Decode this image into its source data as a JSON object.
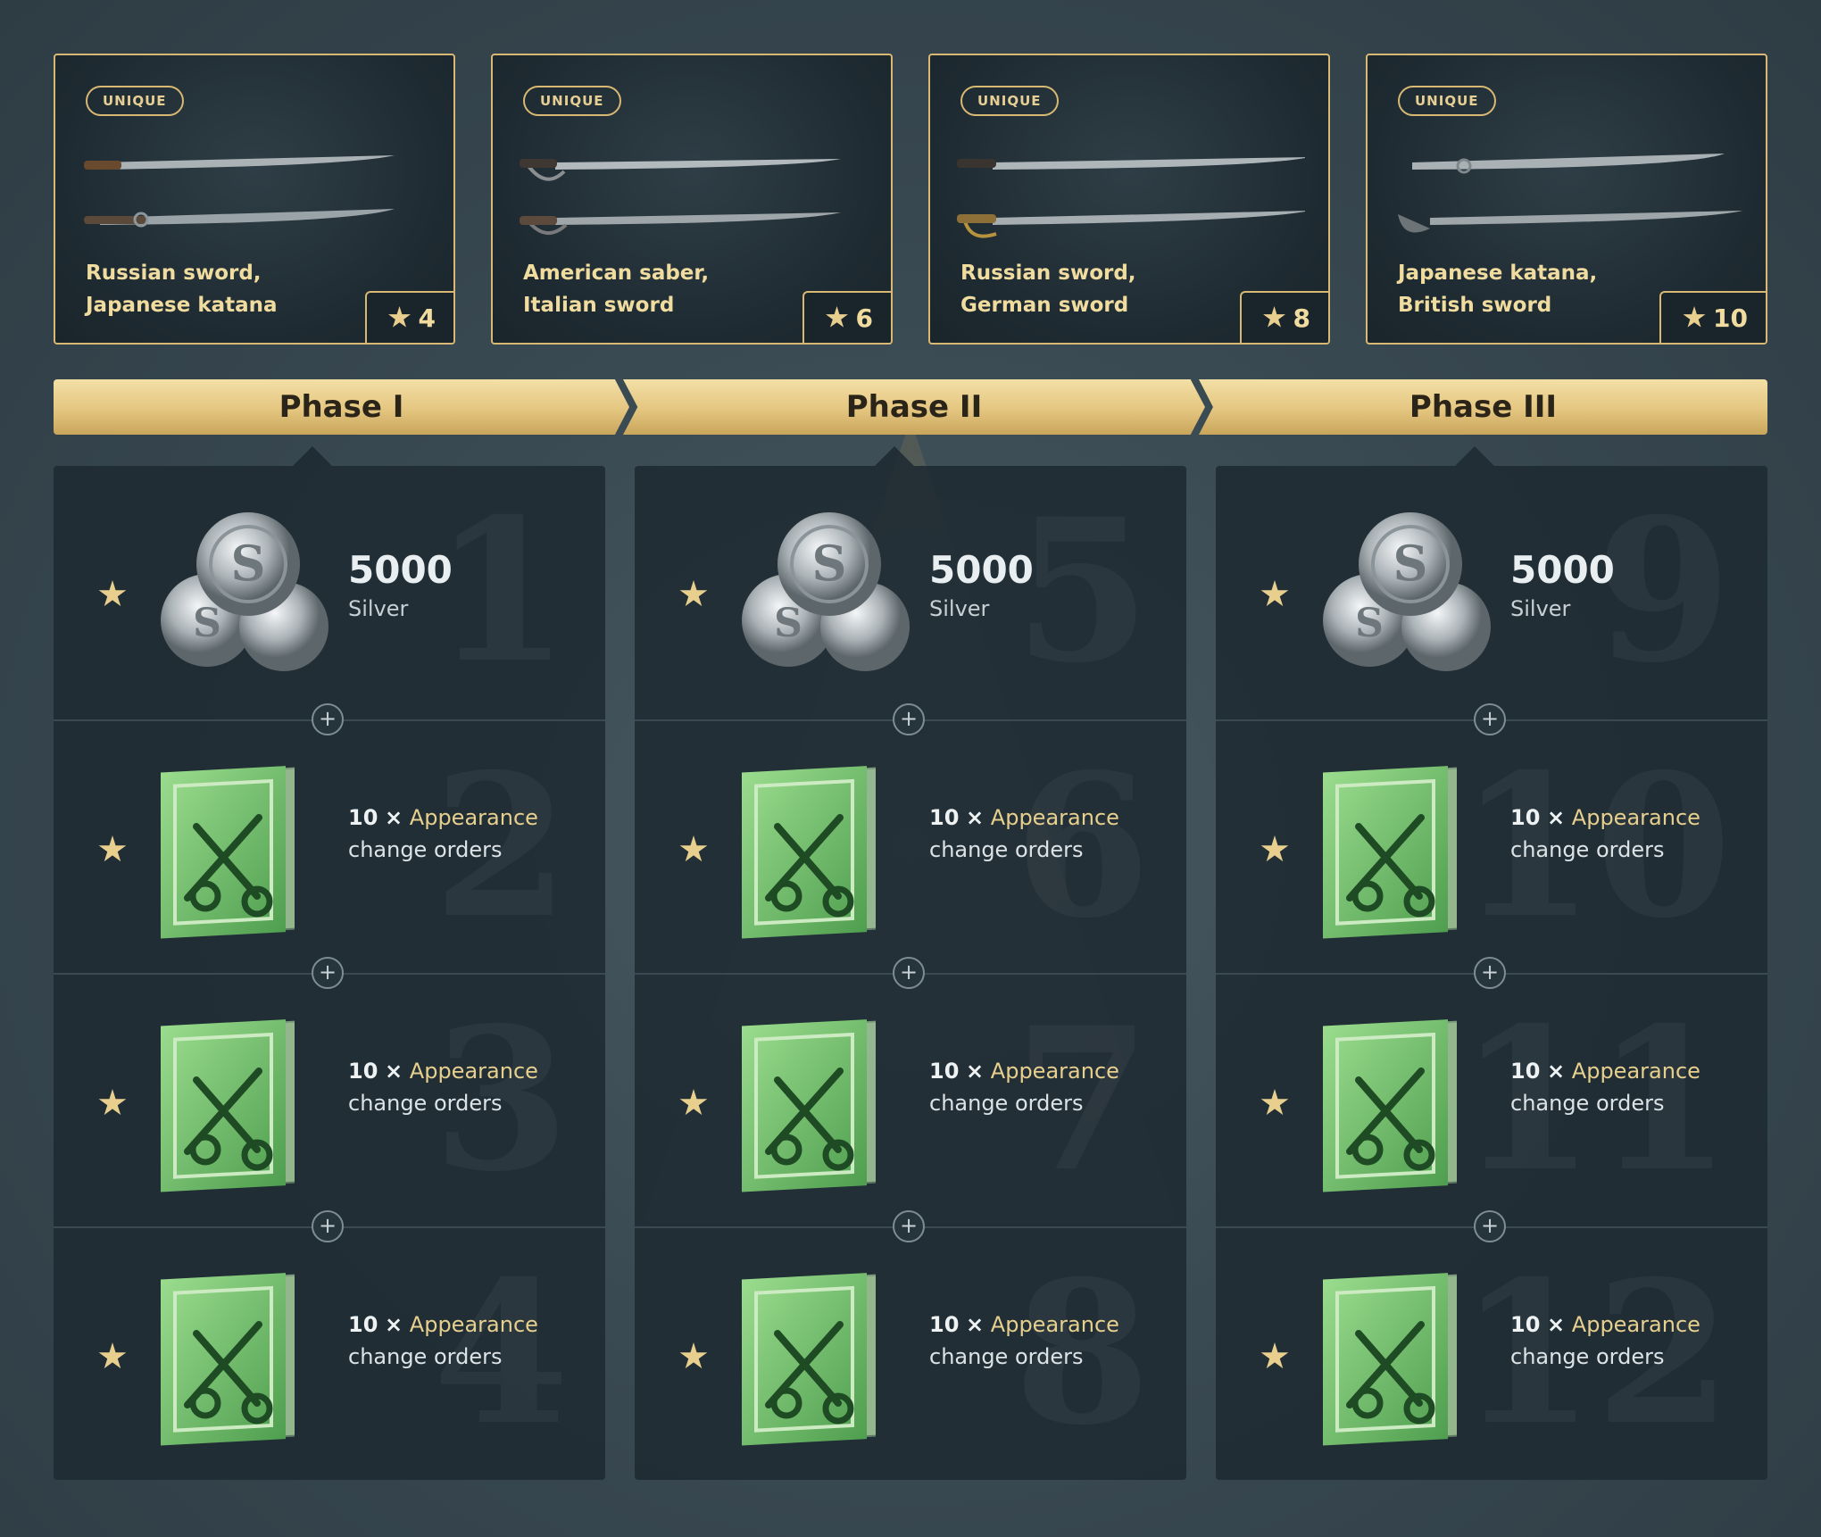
{
  "cards": [
    {
      "badge": "UNIQUE",
      "line1": "Russian sword,",
      "line2": "Japanese katana",
      "rank": "4"
    },
    {
      "badge": "UNIQUE",
      "line1": "American saber,",
      "line2": "Italian sword",
      "rank": "6"
    },
    {
      "badge": "UNIQUE",
      "line1": "Russian sword,",
      "line2": "German sword",
      "rank": "8"
    },
    {
      "badge": "UNIQUE",
      "line1": "Japanese katana,",
      "line2": "British sword",
      "rank": "10"
    }
  ],
  "phases": [
    "Phase I",
    "Phase II",
    "Phase III"
  ],
  "rewards": {
    "silver": {
      "amount": "5000",
      "label": "Silver"
    },
    "orders": {
      "qty": "10",
      "times": "×",
      "name_part1": "Appearance",
      "name_part2": "change orders"
    }
  },
  "plus_symbol": "+",
  "columns": [
    {
      "numbers": [
        "1",
        "2",
        "3",
        "4"
      ]
    },
    {
      "numbers": [
        "5",
        "6",
        "7",
        "8"
      ]
    },
    {
      "numbers": [
        "9",
        "10",
        "11",
        "12"
      ]
    }
  ],
  "icons": {
    "star": "star-icon",
    "silver": "silver-coins-icon",
    "orders": "appearance-orders-icon",
    "swords": "swords-icon"
  },
  "colors": {
    "gold": "#d8b872",
    "panel": "#1e2a32",
    "green": "#6fbf6a"
  }
}
